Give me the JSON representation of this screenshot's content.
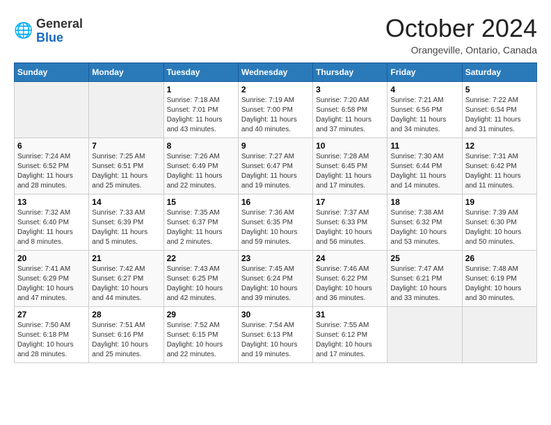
{
  "header": {
    "logo": {
      "general": "General",
      "blue": "Blue"
    },
    "title": "October 2024",
    "location": "Orangeville, Ontario, Canada"
  },
  "weekdays": [
    "Sunday",
    "Monday",
    "Tuesday",
    "Wednesday",
    "Thursday",
    "Friday",
    "Saturday"
  ],
  "weeks": [
    [
      null,
      null,
      {
        "day": 1,
        "sunrise": "Sunrise: 7:18 AM",
        "sunset": "Sunset: 7:01 PM",
        "daylight": "Daylight: 11 hours and 43 minutes."
      },
      {
        "day": 2,
        "sunrise": "Sunrise: 7:19 AM",
        "sunset": "Sunset: 7:00 PM",
        "daylight": "Daylight: 11 hours and 40 minutes."
      },
      {
        "day": 3,
        "sunrise": "Sunrise: 7:20 AM",
        "sunset": "Sunset: 6:58 PM",
        "daylight": "Daylight: 11 hours and 37 minutes."
      },
      {
        "day": 4,
        "sunrise": "Sunrise: 7:21 AM",
        "sunset": "Sunset: 6:56 PM",
        "daylight": "Daylight: 11 hours and 34 minutes."
      },
      {
        "day": 5,
        "sunrise": "Sunrise: 7:22 AM",
        "sunset": "Sunset: 6:54 PM",
        "daylight": "Daylight: 11 hours and 31 minutes."
      }
    ],
    [
      {
        "day": 6,
        "sunrise": "Sunrise: 7:24 AM",
        "sunset": "Sunset: 6:52 PM",
        "daylight": "Daylight: 11 hours and 28 minutes."
      },
      {
        "day": 7,
        "sunrise": "Sunrise: 7:25 AM",
        "sunset": "Sunset: 6:51 PM",
        "daylight": "Daylight: 11 hours and 25 minutes."
      },
      {
        "day": 8,
        "sunrise": "Sunrise: 7:26 AM",
        "sunset": "Sunset: 6:49 PM",
        "daylight": "Daylight: 11 hours and 22 minutes."
      },
      {
        "day": 9,
        "sunrise": "Sunrise: 7:27 AM",
        "sunset": "Sunset: 6:47 PM",
        "daylight": "Daylight: 11 hours and 19 minutes."
      },
      {
        "day": 10,
        "sunrise": "Sunrise: 7:28 AM",
        "sunset": "Sunset: 6:45 PM",
        "daylight": "Daylight: 11 hours and 17 minutes."
      },
      {
        "day": 11,
        "sunrise": "Sunrise: 7:30 AM",
        "sunset": "Sunset: 6:44 PM",
        "daylight": "Daylight: 11 hours and 14 minutes."
      },
      {
        "day": 12,
        "sunrise": "Sunrise: 7:31 AM",
        "sunset": "Sunset: 6:42 PM",
        "daylight": "Daylight: 11 hours and 11 minutes."
      }
    ],
    [
      {
        "day": 13,
        "sunrise": "Sunrise: 7:32 AM",
        "sunset": "Sunset: 6:40 PM",
        "daylight": "Daylight: 11 hours and 8 minutes."
      },
      {
        "day": 14,
        "sunrise": "Sunrise: 7:33 AM",
        "sunset": "Sunset: 6:39 PM",
        "daylight": "Daylight: 11 hours and 5 minutes."
      },
      {
        "day": 15,
        "sunrise": "Sunrise: 7:35 AM",
        "sunset": "Sunset: 6:37 PM",
        "daylight": "Daylight: 11 hours and 2 minutes."
      },
      {
        "day": 16,
        "sunrise": "Sunrise: 7:36 AM",
        "sunset": "Sunset: 6:35 PM",
        "daylight": "Daylight: 10 hours and 59 minutes."
      },
      {
        "day": 17,
        "sunrise": "Sunrise: 7:37 AM",
        "sunset": "Sunset: 6:33 PM",
        "daylight": "Daylight: 10 hours and 56 minutes."
      },
      {
        "day": 18,
        "sunrise": "Sunrise: 7:38 AM",
        "sunset": "Sunset: 6:32 PM",
        "daylight": "Daylight: 10 hours and 53 minutes."
      },
      {
        "day": 19,
        "sunrise": "Sunrise: 7:39 AM",
        "sunset": "Sunset: 6:30 PM",
        "daylight": "Daylight: 10 hours and 50 minutes."
      }
    ],
    [
      {
        "day": 20,
        "sunrise": "Sunrise: 7:41 AM",
        "sunset": "Sunset: 6:29 PM",
        "daylight": "Daylight: 10 hours and 47 minutes."
      },
      {
        "day": 21,
        "sunrise": "Sunrise: 7:42 AM",
        "sunset": "Sunset: 6:27 PM",
        "daylight": "Daylight: 10 hours and 44 minutes."
      },
      {
        "day": 22,
        "sunrise": "Sunrise: 7:43 AM",
        "sunset": "Sunset: 6:25 PM",
        "daylight": "Daylight: 10 hours and 42 minutes."
      },
      {
        "day": 23,
        "sunrise": "Sunrise: 7:45 AM",
        "sunset": "Sunset: 6:24 PM",
        "daylight": "Daylight: 10 hours and 39 minutes."
      },
      {
        "day": 24,
        "sunrise": "Sunrise: 7:46 AM",
        "sunset": "Sunset: 6:22 PM",
        "daylight": "Daylight: 10 hours and 36 minutes."
      },
      {
        "day": 25,
        "sunrise": "Sunrise: 7:47 AM",
        "sunset": "Sunset: 6:21 PM",
        "daylight": "Daylight: 10 hours and 33 minutes."
      },
      {
        "day": 26,
        "sunrise": "Sunrise: 7:48 AM",
        "sunset": "Sunset: 6:19 PM",
        "daylight": "Daylight: 10 hours and 30 minutes."
      }
    ],
    [
      {
        "day": 27,
        "sunrise": "Sunrise: 7:50 AM",
        "sunset": "Sunset: 6:18 PM",
        "daylight": "Daylight: 10 hours and 28 minutes."
      },
      {
        "day": 28,
        "sunrise": "Sunrise: 7:51 AM",
        "sunset": "Sunset: 6:16 PM",
        "daylight": "Daylight: 10 hours and 25 minutes."
      },
      {
        "day": 29,
        "sunrise": "Sunrise: 7:52 AM",
        "sunset": "Sunset: 6:15 PM",
        "daylight": "Daylight: 10 hours and 22 minutes."
      },
      {
        "day": 30,
        "sunrise": "Sunrise: 7:54 AM",
        "sunset": "Sunset: 6:13 PM",
        "daylight": "Daylight: 10 hours and 19 minutes."
      },
      {
        "day": 31,
        "sunrise": "Sunrise: 7:55 AM",
        "sunset": "Sunset: 6:12 PM",
        "daylight": "Daylight: 10 hours and 17 minutes."
      },
      null,
      null
    ]
  ]
}
